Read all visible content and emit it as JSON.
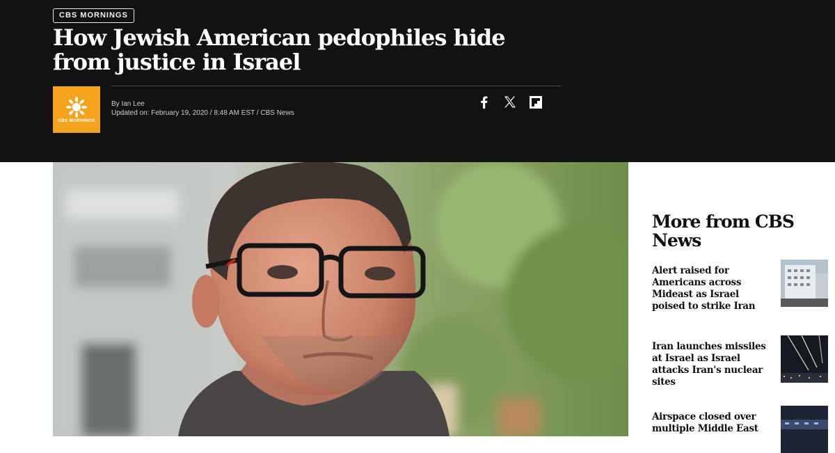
{
  "article": {
    "topic": "CBS MORNINGS",
    "headline": "How Jewish American pedophiles hide from justice in Israel",
    "logo_text": "CBS MORNINGS",
    "byline_prefix": "By ",
    "author": "Ian Lee",
    "updated": "Updated on: February 19, 2020 / 8:48 AM EST / CBS News"
  },
  "share": {
    "facebook_icon": "facebook-icon",
    "x_icon": "x-icon",
    "flipboard_icon": "flipboard-icon"
  },
  "colors": {
    "hero_bg": "#121212",
    "logo_bg": "#f5a31e",
    "text_dark": "#111111"
  },
  "rail": {
    "title": "More from CBS News",
    "items": [
      {
        "headline": "Alert raised for Americans across Mideast as Israel poised to strike Iran"
      },
      {
        "headline": "Iran launches missiles at Israel as Israel attacks Iran's nuclear sites"
      },
      {
        "headline": "Airspace closed over multiple Middle East"
      }
    ]
  }
}
